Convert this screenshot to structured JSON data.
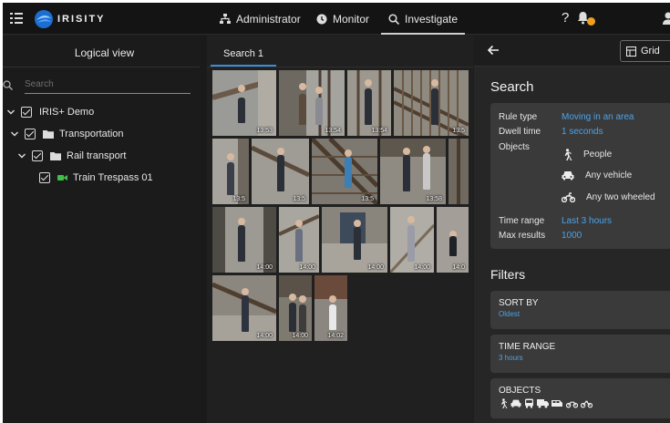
{
  "header": {
    "brand": "IRISITY",
    "tabs": [
      {
        "label": "Administrator"
      },
      {
        "label": "Monitor"
      },
      {
        "label": "Investigate"
      }
    ],
    "help": "?"
  },
  "left_panel": {
    "title": "Logical view",
    "search_placeholder": "Search",
    "tree": [
      {
        "label": "IRIS+ Demo"
      },
      {
        "label": "Transportation"
      },
      {
        "label": "Rail transport"
      },
      {
        "label": "Train Trespass 01"
      }
    ]
  },
  "center": {
    "tab": "Search 1",
    "thumbnails": [
      {
        "time": "13:53"
      },
      {
        "time": "13:54"
      },
      {
        "time": "13:54"
      },
      {
        "time": "13:5"
      },
      {
        "time": "13:5"
      },
      {
        "time": "13:5"
      },
      {
        "time": "13:5"
      },
      {
        "time": "13:58"
      },
      {
        "time": ""
      },
      {
        "time": "14:00"
      },
      {
        "time": "14:00"
      },
      {
        "time": "14:00"
      },
      {
        "time": "14:00"
      },
      {
        "time": "14:0"
      },
      {
        "time": "14:00"
      },
      {
        "time": "14:00"
      },
      {
        "time": "14:02"
      }
    ]
  },
  "right_panel": {
    "view_button": "Grid",
    "search_title": "Search",
    "search": {
      "rule_type_label": "Rule type",
      "rule_type_value": "Moving in an area",
      "dwell_label": "Dwell time",
      "dwell_value": "1 seconds",
      "objects_label": "Objects",
      "objects": [
        "People",
        "Any vehicle",
        "Any two wheeled"
      ],
      "time_range_label": "Time range",
      "time_range_value": "Last 3 hours",
      "max_results_label": "Max results",
      "max_results_value": "1000"
    },
    "filters_title": "Filters",
    "filters": [
      {
        "title": "SORT BY",
        "value": "Oldest"
      },
      {
        "title": "TIME RANGE",
        "value": "3 hours"
      },
      {
        "title": "OBJECTS",
        "value": ""
      }
    ]
  },
  "colors": {
    "accent_blue": "#4aa3ea",
    "tab_underline": "#3b8fd9",
    "badge": "#f0a020"
  }
}
